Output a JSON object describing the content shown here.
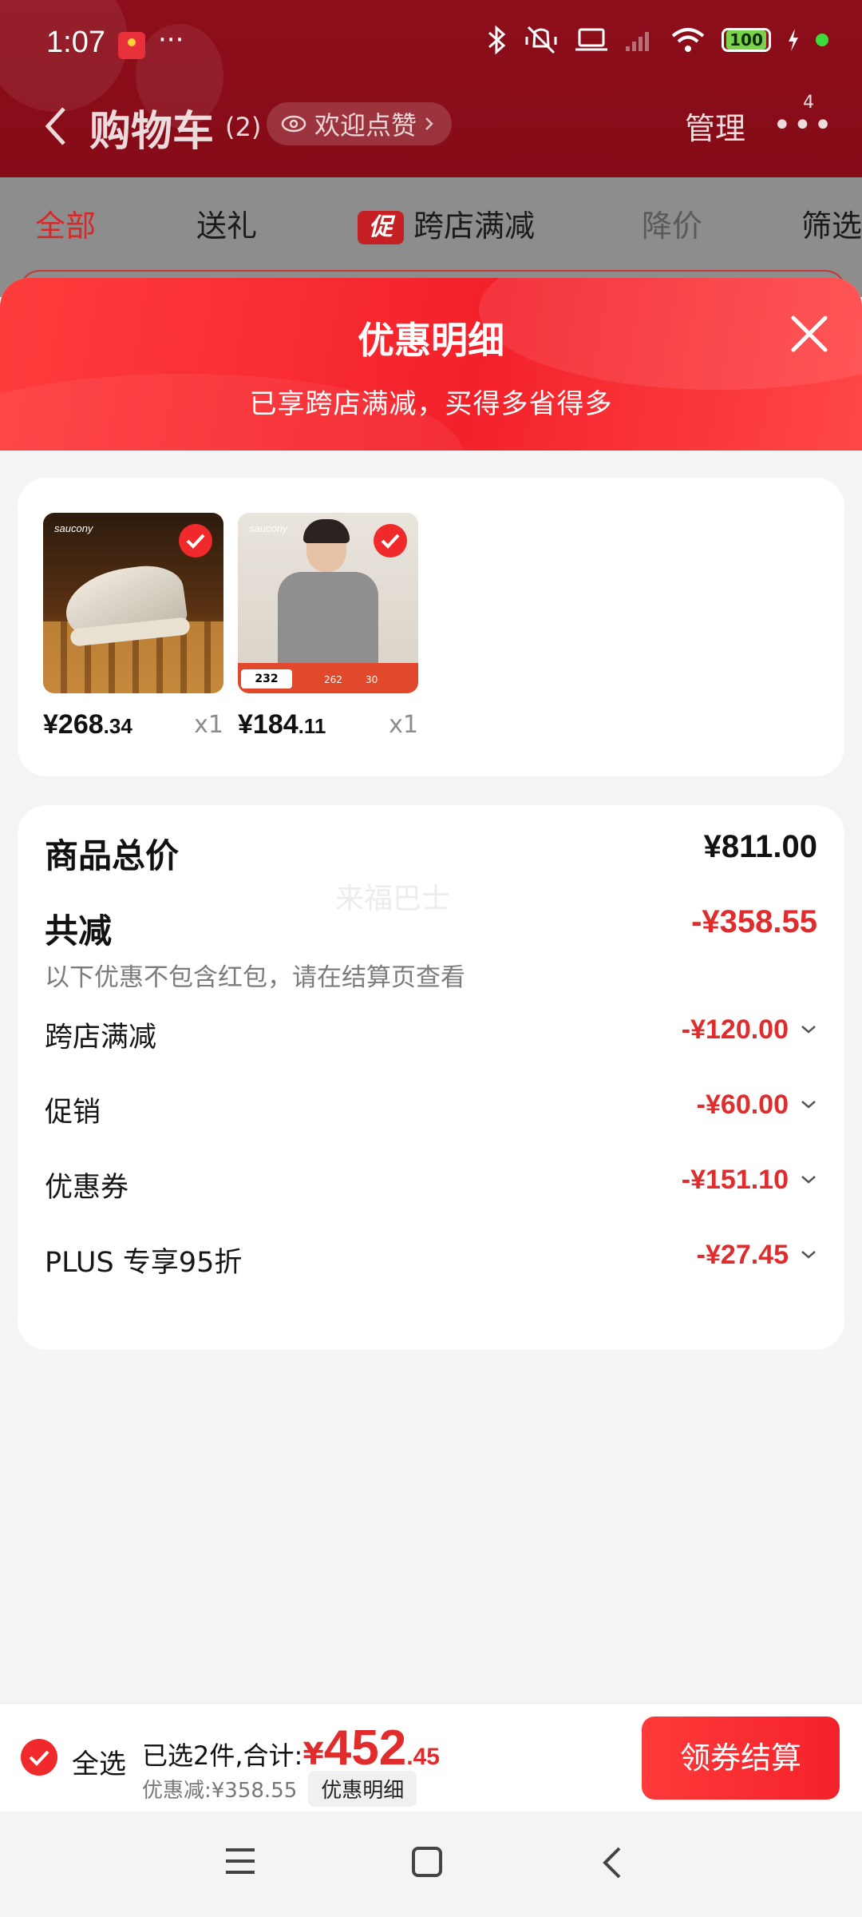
{
  "status_bar": {
    "time": "1:07",
    "more": "···",
    "battery": "100",
    "icons": [
      "notification-app-icon",
      "bluetooth-icon",
      "silent-vibrate-icon",
      "laptop-icon",
      "signal-icon",
      "wifi-icon",
      "battery-icon",
      "charging-icon"
    ]
  },
  "nav": {
    "title": "购物车",
    "count": "(2)",
    "like_label": "欢迎点赞",
    "manage": "管理",
    "more_badge": "4"
  },
  "filter_tabs": [
    {
      "label": "全部"
    },
    {
      "label": "送礼"
    },
    {
      "label": "跨店满减",
      "tag": "促"
    },
    {
      "label": "降价"
    },
    {
      "label": "筛选"
    }
  ],
  "sheet": {
    "title": "优惠明细",
    "subtitle": "已享跨店满减，买得多省得多"
  },
  "products": [
    {
      "brand": "saucony",
      "price_int": "¥268",
      "price_dec": ".34",
      "qty": "x1"
    },
    {
      "brand": "saucony",
      "price_int": "¥184",
      "price_dec": ".11",
      "qty": "x1",
      "promo_value": "232",
      "promo_nums": [
        "262",
        "30"
      ]
    }
  ],
  "details": {
    "total_label": "商品总价",
    "total_value": "¥811.00",
    "reduce_label": "共减",
    "reduce_value": "-¥358.55",
    "note": "以下优惠不包含红包，请在结算页查看",
    "watermark": "来福巴士",
    "items": [
      {
        "label": "跨店满减",
        "value": "-¥120.00"
      },
      {
        "label": "促销",
        "value": "-¥60.00"
      },
      {
        "label": "优惠券",
        "value": "-¥151.10"
      },
      {
        "label": "PLUS 专享95折",
        "value": "-¥27.45"
      }
    ]
  },
  "bottom_bar": {
    "select_all": "全选",
    "summary_prefix": "已选2件,合计:",
    "yen": "¥",
    "total_int": "452",
    "total_dec": ".45",
    "discount": "优惠减:¥358.55",
    "detail_link": "优惠明细",
    "checkout": "领券结算"
  },
  "colors": {
    "accent_red": "#e02c2c",
    "header_red": "#8d0e1a",
    "button_red": "#f3222a"
  }
}
